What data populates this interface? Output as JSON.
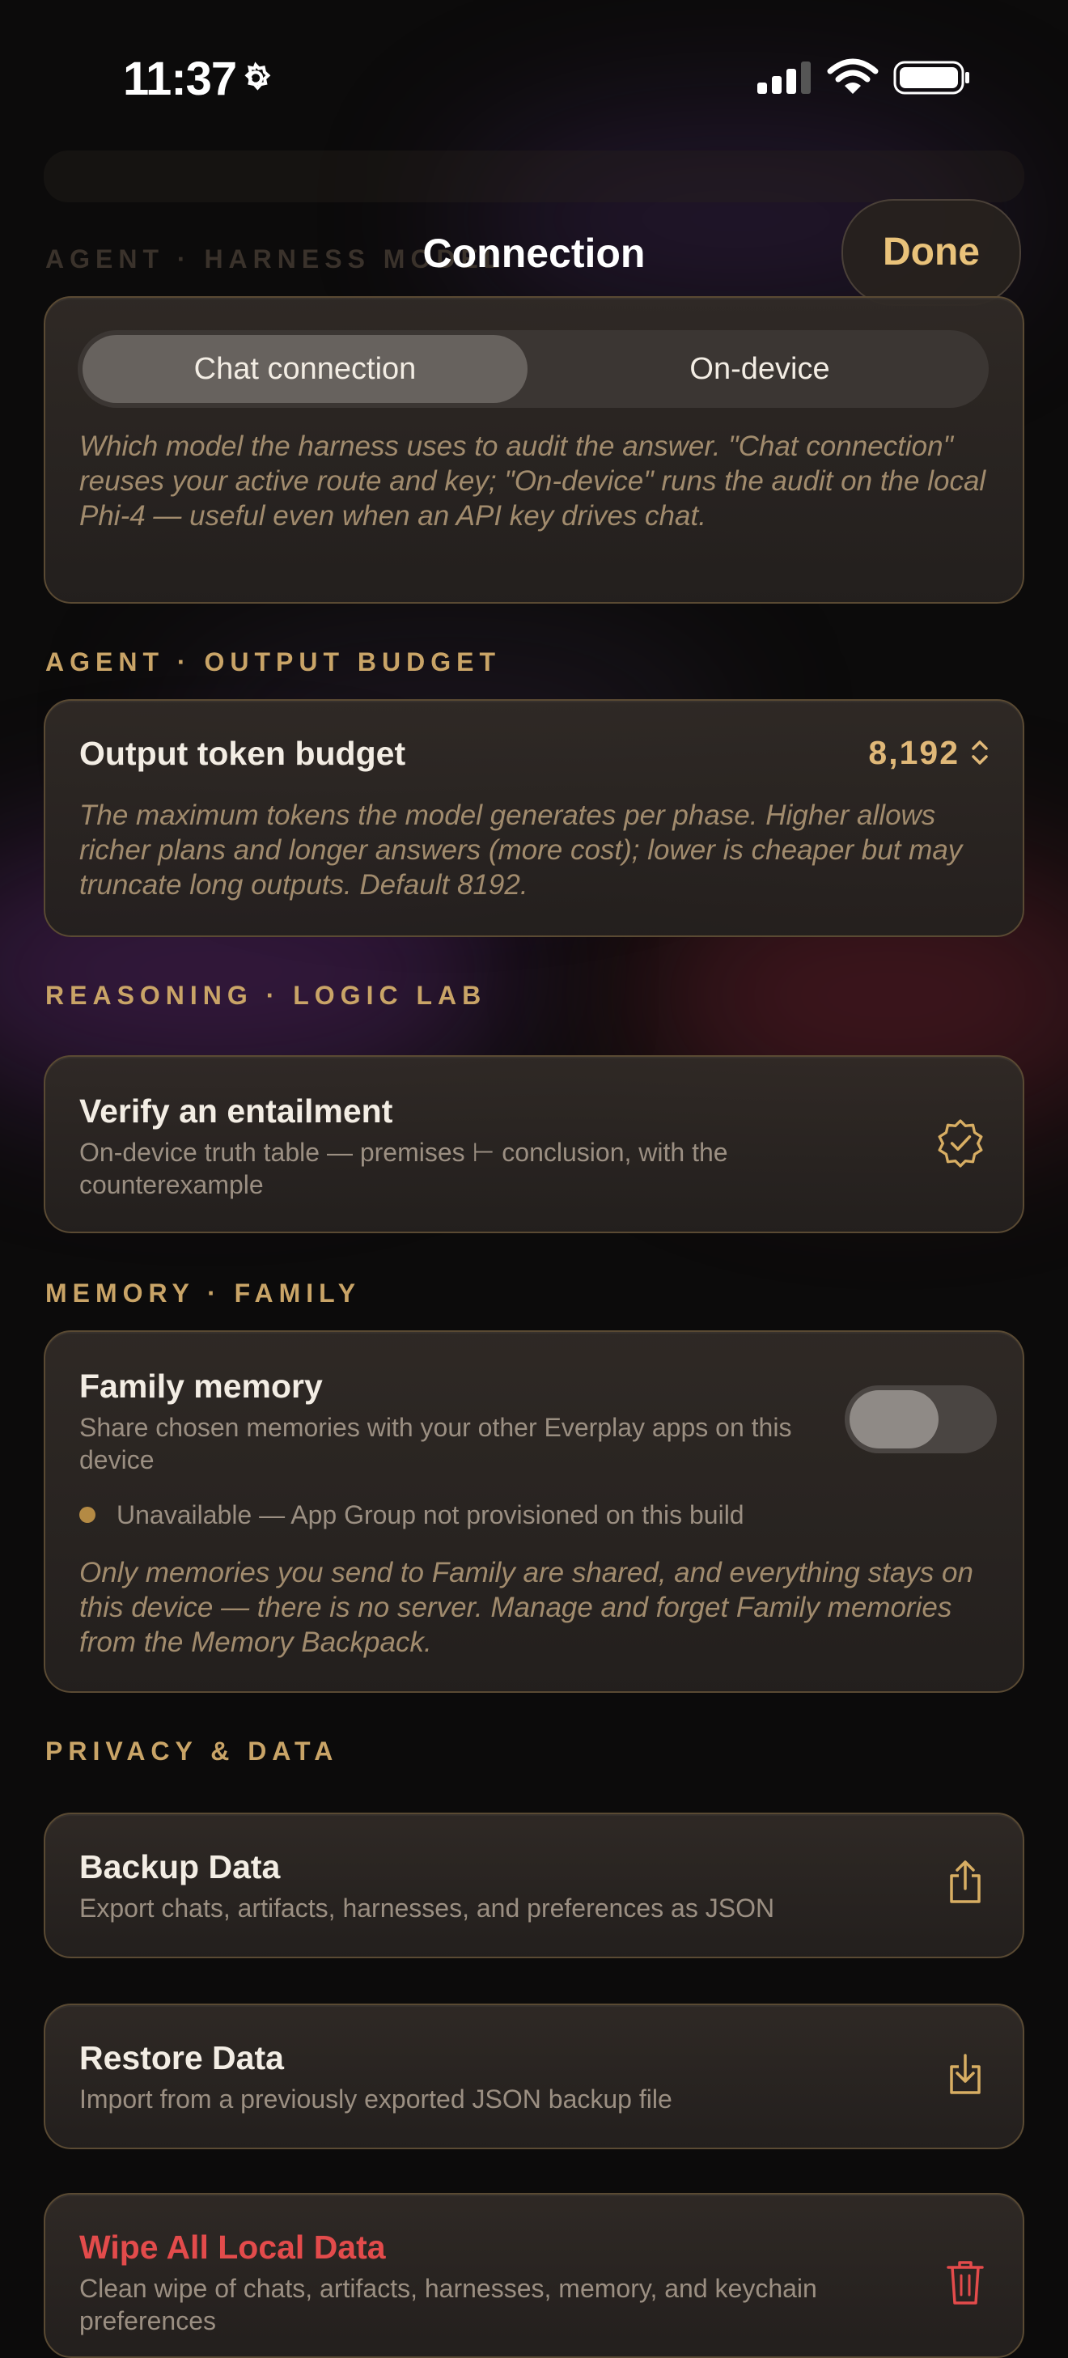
{
  "status_bar": {
    "time": "11:37"
  },
  "nav": {
    "title": "Connection",
    "done": "Done"
  },
  "ghost_section": "AGENT · HARNESS MODEL",
  "harness": {
    "segments": [
      "Chat connection",
      "On-device"
    ],
    "selected": "Chat connection",
    "description": "Which model the harness uses to audit the answer. \"Chat connection\" reuses your active route and key; \"On-device\" runs the audit on the local Phi-4 — useful even when an API key drives chat."
  },
  "output_budget": {
    "section": "AGENT · OUTPUT BUDGET",
    "title": "Output token budget",
    "value": "8,192",
    "description": "The maximum tokens the model generates per phase. Higher allows richer plans and longer answers (more cost); lower is cheaper but may truncate long outputs. Default 8192."
  },
  "logic_lab": {
    "section": "REASONING · LOGIC LAB",
    "title": "Verify an entailment",
    "subtitle": "On-device truth table — premises ⊢ conclusion, with the counterexample"
  },
  "family": {
    "section": "MEMORY · FAMILY",
    "title": "Family memory",
    "subtitle": "Share chosen memories with your other Everplay apps on this device",
    "toggle_on": false,
    "status": "Unavailable — App Group not provisioned on this build",
    "note": "Only memories you send to Family are shared, and everything stays on this device — there is no server. Manage and forget Family memories from the Memory Backpack."
  },
  "privacy": {
    "section": "PRIVACY & DATA",
    "backup": {
      "title": "Backup Data",
      "subtitle": "Export chats, artifacts, harnesses, and preferences as JSON"
    },
    "restore": {
      "title": "Restore Data",
      "subtitle": "Import from a previously exported JSON backup file"
    },
    "wipe": {
      "title": "Wipe All Local Data",
      "subtitle": "Clean wipe of chats, artifacts, harnesses, memory, and keychain preferences"
    }
  },
  "colors": {
    "accent": "#e0b878",
    "danger": "#e34b4b",
    "background": "#0c0b0b"
  }
}
